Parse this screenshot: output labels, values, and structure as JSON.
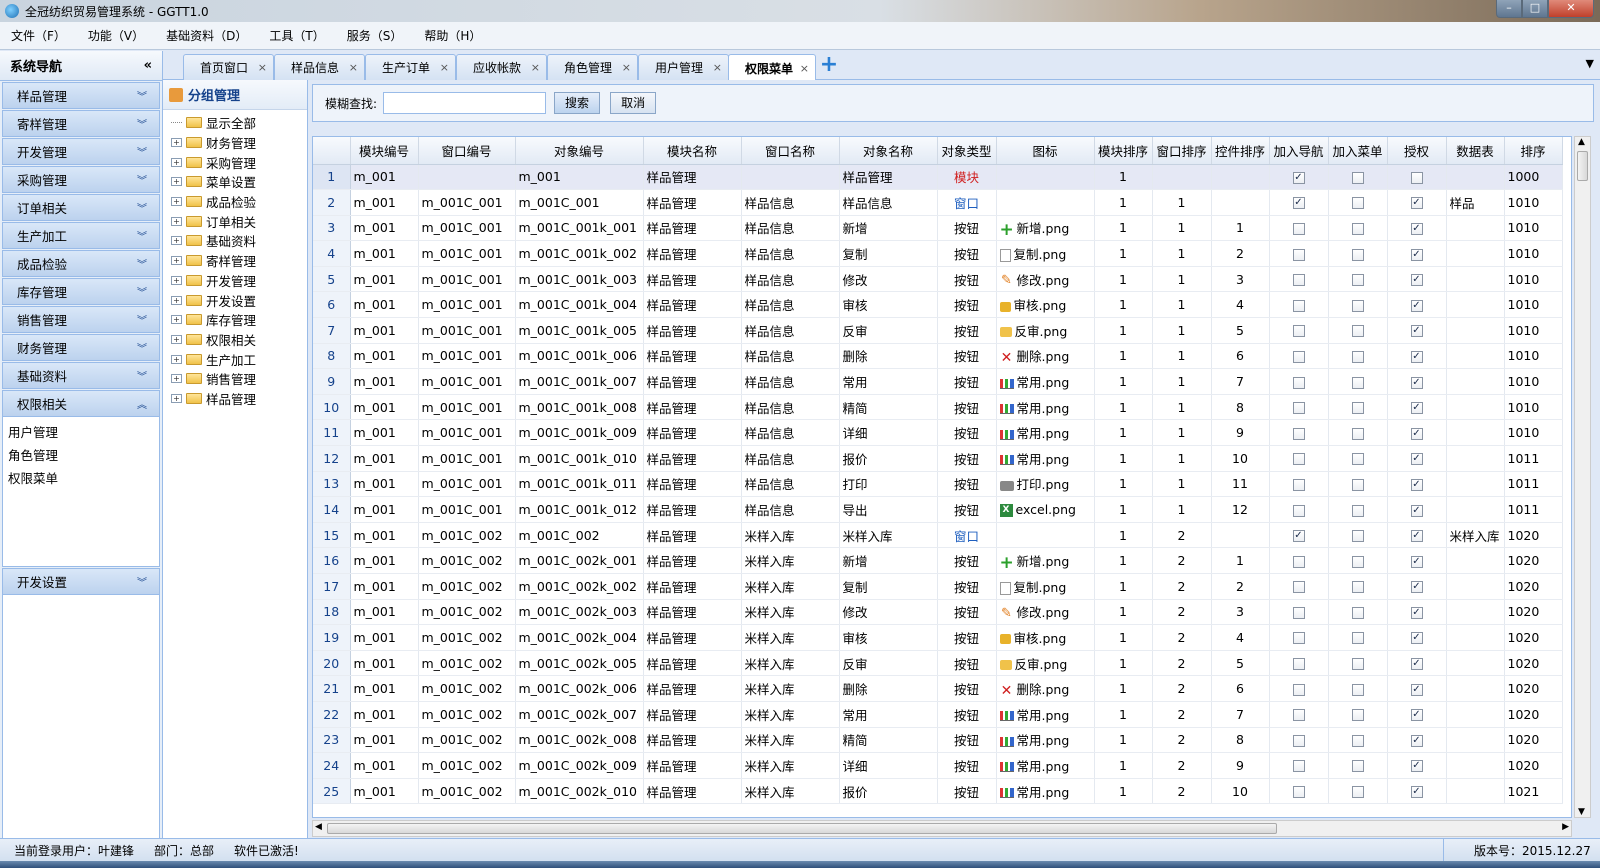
{
  "window": {
    "title": "全冠纺织贸易管理系统 - GGTT1.0"
  },
  "menu": [
    "文件（F）",
    "功能（V）",
    "基础资料（D）",
    "工具（T）",
    "服务（S）",
    "帮助（H）"
  ],
  "sidebar": {
    "title": "系统导航",
    "collapse": "«",
    "items": [
      "样品管理",
      "寄样管理",
      "开发管理",
      "采购管理",
      "订单相关",
      "生产加工",
      "成品检验",
      "库存管理",
      "销售管理",
      "财务管理",
      "基础资料"
    ],
    "expanded": {
      "label": "权限相关",
      "subitems": [
        "用户管理",
        "角色管理",
        "权限菜单"
      ]
    },
    "last": "开发设置"
  },
  "tabs": {
    "items": [
      "首页窗口",
      "样品信息",
      "生产订单",
      "应收帐款",
      "角色管理",
      "用户管理",
      "权限菜单"
    ],
    "active_index": 6,
    "close": "×",
    "add": "+",
    "dropdown": "▼"
  },
  "group": {
    "title": "分组管理",
    "tree": [
      "显示全部",
      "财务管理",
      "采购管理",
      "菜单设置",
      "成品检验",
      "订单相关",
      "基础资料",
      "寄样管理",
      "开发管理",
      "开发设置",
      "库存管理",
      "权限相关",
      "生产加工",
      "销售管理",
      "样品管理"
    ]
  },
  "search": {
    "label": "模糊查找:",
    "value": "",
    "search_button": "搜索",
    "cancel_button": "取消"
  },
  "grid": {
    "columns": [
      "",
      "模块编号",
      "窗口编号",
      "对象编号",
      "模块名称",
      "窗口名称",
      "对象名称",
      "对象类型",
      "图标",
      "模块排序",
      "窗口排序",
      "控件排序",
      "加入导航",
      "加入菜单",
      "授权",
      "数据表",
      "排序"
    ],
    "rows": [
      [
        "1",
        "m_001",
        "",
        "m_001",
        "样品管理",
        "",
        "样品管理",
        "模块",
        "",
        "1",
        "",
        "",
        true,
        false,
        false,
        "",
        "1000"
      ],
      [
        "2",
        "m_001",
        "m_001C_001",
        "m_001C_001",
        "样品管理",
        "样品信息",
        "样品信息",
        "窗口",
        "",
        "1",
        "1",
        "",
        true,
        false,
        true,
        "样品",
        "1010"
      ],
      [
        "3",
        "m_001",
        "m_001C_001",
        "m_001C_001k_001",
        "样品管理",
        "样品信息",
        "新增",
        "按钮",
        "新增.png",
        "1",
        "1",
        "1",
        false,
        false,
        true,
        "",
        "1010"
      ],
      [
        "4",
        "m_001",
        "m_001C_001",
        "m_001C_001k_002",
        "样品管理",
        "样品信息",
        "复制",
        "按钮",
        "复制.png",
        "1",
        "1",
        "2",
        false,
        false,
        true,
        "",
        "1010"
      ],
      [
        "5",
        "m_001",
        "m_001C_001",
        "m_001C_001k_003",
        "样品管理",
        "样品信息",
        "修改",
        "按钮",
        "修改.png",
        "1",
        "1",
        "3",
        false,
        false,
        true,
        "",
        "1010"
      ],
      [
        "6",
        "m_001",
        "m_001C_001",
        "m_001C_001k_004",
        "样品管理",
        "样品信息",
        "审核",
        "按钮",
        "审核.png",
        "1",
        "1",
        "4",
        false,
        false,
        true,
        "",
        "1010"
      ],
      [
        "7",
        "m_001",
        "m_001C_001",
        "m_001C_001k_005",
        "样品管理",
        "样品信息",
        "反审",
        "按钮",
        "反审.png",
        "1",
        "1",
        "5",
        false,
        false,
        true,
        "",
        "1010"
      ],
      [
        "8",
        "m_001",
        "m_001C_001",
        "m_001C_001k_006",
        "样品管理",
        "样品信息",
        "删除",
        "按钮",
        "删除.png",
        "1",
        "1",
        "6",
        false,
        false,
        true,
        "",
        "1010"
      ],
      [
        "9",
        "m_001",
        "m_001C_001",
        "m_001C_001k_007",
        "样品管理",
        "样品信息",
        "常用",
        "按钮",
        "常用.png",
        "1",
        "1",
        "7",
        false,
        false,
        true,
        "",
        "1010"
      ],
      [
        "10",
        "m_001",
        "m_001C_001",
        "m_001C_001k_008",
        "样品管理",
        "样品信息",
        "精简",
        "按钮",
        "常用.png",
        "1",
        "1",
        "8",
        false,
        false,
        true,
        "",
        "1010"
      ],
      [
        "11",
        "m_001",
        "m_001C_001",
        "m_001C_001k_009",
        "样品管理",
        "样品信息",
        "详细",
        "按钮",
        "常用.png",
        "1",
        "1",
        "9",
        false,
        false,
        true,
        "",
        "1010"
      ],
      [
        "12",
        "m_001",
        "m_001C_001",
        "m_001C_001k_010",
        "样品管理",
        "样品信息",
        "报价",
        "按钮",
        "常用.png",
        "1",
        "1",
        "10",
        false,
        false,
        true,
        "",
        "1011"
      ],
      [
        "13",
        "m_001",
        "m_001C_001",
        "m_001C_001k_011",
        "样品管理",
        "样品信息",
        "打印",
        "按钮",
        "打印.png",
        "1",
        "1",
        "11",
        false,
        false,
        true,
        "",
        "1011"
      ],
      [
        "14",
        "m_001",
        "m_001C_001",
        "m_001C_001k_012",
        "样品管理",
        "样品信息",
        "导出",
        "按钮",
        "excel.png",
        "1",
        "1",
        "12",
        false,
        false,
        true,
        "",
        "1011"
      ],
      [
        "15",
        "m_001",
        "m_001C_002",
        "m_001C_002",
        "样品管理",
        "米样入库",
        "米样入库",
        "窗口",
        "",
        "1",
        "2",
        "",
        true,
        false,
        true,
        "米样入库",
        "1020"
      ],
      [
        "16",
        "m_001",
        "m_001C_002",
        "m_001C_002k_001",
        "样品管理",
        "米样入库",
        "新增",
        "按钮",
        "新增.png",
        "1",
        "2",
        "1",
        false,
        false,
        true,
        "",
        "1020"
      ],
      [
        "17",
        "m_001",
        "m_001C_002",
        "m_001C_002k_002",
        "样品管理",
        "米样入库",
        "复制",
        "按钮",
        "复制.png",
        "1",
        "2",
        "2",
        false,
        false,
        true,
        "",
        "1020"
      ],
      [
        "18",
        "m_001",
        "m_001C_002",
        "m_001C_002k_003",
        "样品管理",
        "米样入库",
        "修改",
        "按钮",
        "修改.png",
        "1",
        "2",
        "3",
        false,
        false,
        true,
        "",
        "1020"
      ],
      [
        "19",
        "m_001",
        "m_001C_002",
        "m_001C_002k_004",
        "样品管理",
        "米样入库",
        "审核",
        "按钮",
        "审核.png",
        "1",
        "2",
        "4",
        false,
        false,
        true,
        "",
        "1020"
      ],
      [
        "20",
        "m_001",
        "m_001C_002",
        "m_001C_002k_005",
        "样品管理",
        "米样入库",
        "反审",
        "按钮",
        "反审.png",
        "1",
        "2",
        "5",
        false,
        false,
        true,
        "",
        "1020"
      ],
      [
        "21",
        "m_001",
        "m_001C_002",
        "m_001C_002k_006",
        "样品管理",
        "米样入库",
        "删除",
        "按钮",
        "删除.png",
        "1",
        "2",
        "6",
        false,
        false,
        true,
        "",
        "1020"
      ],
      [
        "22",
        "m_001",
        "m_001C_002",
        "m_001C_002k_007",
        "样品管理",
        "米样入库",
        "常用",
        "按钮",
        "常用.png",
        "1",
        "2",
        "7",
        false,
        false,
        true,
        "",
        "1020"
      ],
      [
        "23",
        "m_001",
        "m_001C_002",
        "m_001C_002k_008",
        "样品管理",
        "米样入库",
        "精简",
        "按钮",
        "常用.png",
        "1",
        "2",
        "8",
        false,
        false,
        true,
        "",
        "1020"
      ],
      [
        "24",
        "m_001",
        "m_001C_002",
        "m_001C_002k_009",
        "样品管理",
        "米样入库",
        "详细",
        "按钮",
        "常用.png",
        "1",
        "2",
        "9",
        false,
        false,
        true,
        "",
        "1020"
      ],
      [
        "25",
        "m_001",
        "m_001C_002",
        "m_001C_002k_010",
        "样品管理",
        "米样入库",
        "报价",
        "按钮",
        "常用.png",
        "1",
        "2",
        "10",
        false,
        false,
        true,
        "",
        "1021"
      ]
    ]
  },
  "status": {
    "user": "当前登录用户：叶建锋",
    "dept": "部门：总部",
    "license": "软件已激活!",
    "version": "版本号：2015.12.27"
  },
  "colors": {
    "accent": "#99bbe8",
    "module_type": "#d02020",
    "window_type": "#1f5fbf"
  }
}
